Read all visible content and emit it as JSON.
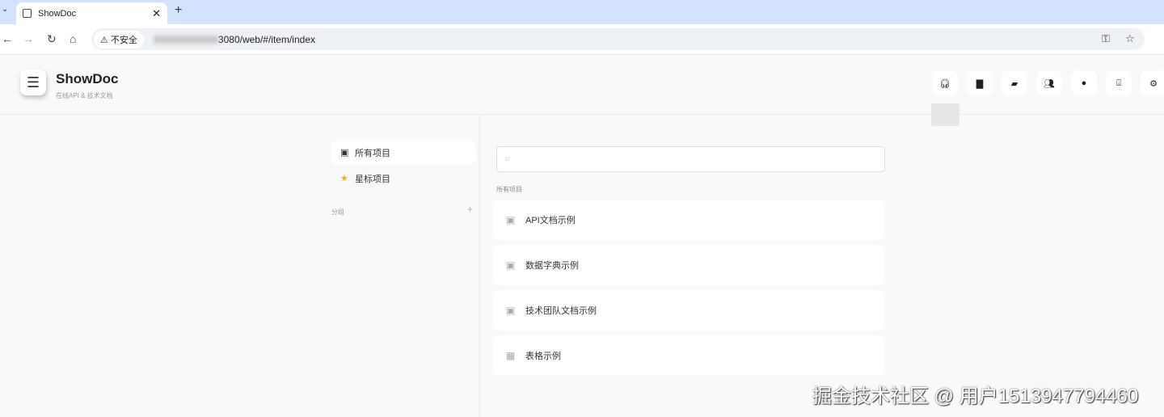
{
  "browser": {
    "tab_title": "ShowDoc",
    "security_label": "不安全",
    "url": "3080/web/#/item/index"
  },
  "header": {
    "title": "ShowDoc",
    "subtitle": "在线API & 技术文档"
  },
  "toolbar": [
    {
      "icon": "headphones-icon"
    },
    {
      "icon": "folder-upload-icon"
    },
    {
      "icon": "message-icon"
    },
    {
      "icon": "team-icon"
    },
    {
      "icon": "user-icon"
    },
    {
      "icon": "download-icon"
    },
    {
      "icon": "gear-icon"
    }
  ],
  "sidebar": {
    "items": [
      {
        "label": "所有项目",
        "icon": "stack-icon"
      },
      {
        "label": "星标项目",
        "icon": "star-icon"
      }
    ],
    "group_label": "分组"
  },
  "main": {
    "search_placeholder": "",
    "section_label": "所有项目",
    "projects": [
      {
        "name": "API文档示例",
        "icon": "stack-icon"
      },
      {
        "name": "数据字典示例",
        "icon": "stack-icon"
      },
      {
        "name": "技术团队文档示例",
        "icon": "stack-icon"
      },
      {
        "name": "表格示例",
        "icon": "table-icon"
      }
    ]
  },
  "watermark": "掘金技术社区 @ 用户1513947794460"
}
